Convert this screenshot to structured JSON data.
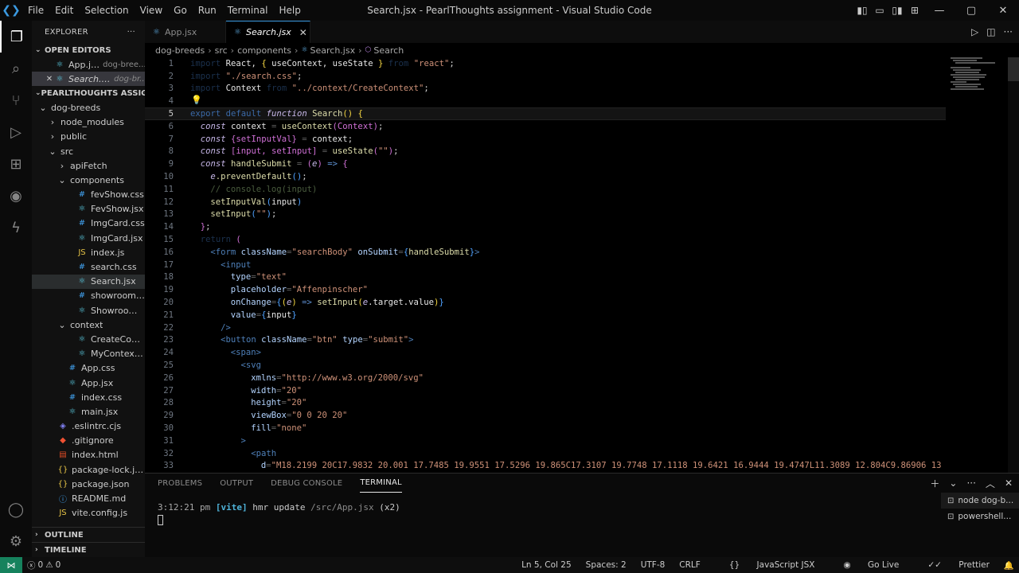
{
  "window": {
    "title": "Search.jsx - PearlThoughts assignment - Visual Studio Code",
    "menu": [
      "File",
      "Edit",
      "Selection",
      "View",
      "Go",
      "Run",
      "Terminal",
      "Help"
    ]
  },
  "explorer": {
    "header": "EXPLORER",
    "more": "···",
    "open_editors_label": "OPEN EDITORS",
    "open_editors": [
      {
        "name": "App.jsx",
        "desc": "dog-bree...",
        "icon": "react-icon",
        "italic": false
      },
      {
        "name": "Search.jsx",
        "desc": "dog-br...",
        "icon": "react-icon",
        "italic": true
      }
    ],
    "project_label": "PEARLTHOUGHTS ASSIGN...",
    "tree": [
      {
        "name": "dog-breeds",
        "depth": 1,
        "type": "folder",
        "open": true
      },
      {
        "name": "node_modules",
        "depth": 2,
        "type": "folder",
        "open": false
      },
      {
        "name": "public",
        "depth": 2,
        "type": "folder",
        "open": false
      },
      {
        "name": "src",
        "depth": 2,
        "type": "folder",
        "open": true
      },
      {
        "name": "apiFetch",
        "depth": 3,
        "type": "folder",
        "open": false
      },
      {
        "name": "components",
        "depth": 3,
        "type": "folder",
        "open": true
      },
      {
        "name": "fevShow.css",
        "depth": 4,
        "type": "css"
      },
      {
        "name": "FevShow.jsx",
        "depth": 4,
        "type": "jsx"
      },
      {
        "name": "ImgCard.css",
        "depth": 4,
        "type": "css"
      },
      {
        "name": "ImgCard.jsx",
        "depth": 4,
        "type": "jsx"
      },
      {
        "name": "index.js",
        "depth": 4,
        "type": "js"
      },
      {
        "name": "search.css",
        "depth": 4,
        "type": "css"
      },
      {
        "name": "Search.jsx",
        "depth": 4,
        "type": "jsx",
        "selected": true
      },
      {
        "name": "showroom.css",
        "depth": 4,
        "type": "css"
      },
      {
        "name": "Showroom.jsx",
        "depth": 4,
        "type": "jsx"
      },
      {
        "name": "context",
        "depth": 3,
        "type": "folder",
        "open": true
      },
      {
        "name": "CreateContex...",
        "depth": 4,
        "type": "jsx"
      },
      {
        "name": "MyContext.jsx",
        "depth": 4,
        "type": "jsx"
      },
      {
        "name": "App.css",
        "depth": 3,
        "type": "css"
      },
      {
        "name": "App.jsx",
        "depth": 3,
        "type": "jsx"
      },
      {
        "name": "index.css",
        "depth": 3,
        "type": "css"
      },
      {
        "name": "main.jsx",
        "depth": 3,
        "type": "jsx"
      },
      {
        "name": ".eslintrc.cjs",
        "depth": 2,
        "type": "eslint"
      },
      {
        "name": ".gitignore",
        "depth": 2,
        "type": "git"
      },
      {
        "name": "index.html",
        "depth": 2,
        "type": "html"
      },
      {
        "name": "package-lock.json",
        "depth": 2,
        "type": "json"
      },
      {
        "name": "package.json",
        "depth": 2,
        "type": "json"
      },
      {
        "name": "README.md",
        "depth": 2,
        "type": "md"
      },
      {
        "name": "vite.config.js",
        "depth": 2,
        "type": "js"
      }
    ],
    "outline_label": "OUTLINE",
    "timeline_label": "TIMELINE"
  },
  "tabs": [
    {
      "label": "App.jsx",
      "active": false
    },
    {
      "label": "Search.jsx",
      "active": true
    }
  ],
  "breadcrumb": [
    "dog-breeds",
    "src",
    "components",
    "Search.jsx",
    "Search"
  ],
  "editor": {
    "current_line": 5,
    "lines": [
      {
        "n": 1,
        "ind": 0,
        "t": [
          [
            "import",
            "kw dim"
          ],
          [
            " React, ",
            "var"
          ],
          [
            "{ ",
            "br1"
          ],
          [
            "useContext, useState ",
            "var"
          ],
          [
            "}",
            "br1"
          ],
          [
            " from ",
            "kw dim"
          ],
          [
            "\"react\"",
            "str"
          ],
          [
            ";",
            "pun"
          ]
        ]
      },
      {
        "n": 2,
        "ind": 0,
        "t": [
          [
            "import ",
            "kw dim"
          ],
          [
            "\"./search.css\"",
            "str"
          ],
          [
            ";",
            "pun"
          ]
        ]
      },
      {
        "n": 3,
        "ind": 0,
        "t": [
          [
            "import ",
            "kw dim"
          ],
          [
            "Context ",
            "var"
          ],
          [
            "from ",
            "kw dim"
          ],
          [
            "\"../context/CreateContext\"",
            "str"
          ],
          [
            ";",
            "pun"
          ]
        ]
      },
      {
        "n": 4,
        "ind": 0,
        "t": []
      },
      {
        "n": 5,
        "ind": 0,
        "t": [
          [
            "export default ",
            "kw"
          ],
          [
            "function ",
            "it"
          ],
          [
            "Search",
            "fn"
          ],
          [
            "() ",
            "br1"
          ],
          [
            "{",
            "br1"
          ]
        ]
      },
      {
        "n": 6,
        "ind": 1,
        "t": [
          [
            "const ",
            "it"
          ],
          [
            "context",
            "var"
          ],
          [
            " = ",
            "pun dim"
          ],
          [
            "useContext",
            "fn"
          ],
          [
            "(Context)",
            "br2"
          ],
          [
            ";",
            "pun"
          ]
        ]
      },
      {
        "n": 7,
        "ind": 1,
        "t": [
          [
            "const ",
            "it"
          ],
          [
            "{setInputVal}",
            "br2"
          ],
          [
            " = ",
            "pun dim"
          ],
          [
            "context",
            "var"
          ],
          [
            ";",
            "pun"
          ]
        ]
      },
      {
        "n": 8,
        "ind": 1,
        "t": [
          [
            "const ",
            "it"
          ],
          [
            "[input, setInput]",
            "br2"
          ],
          [
            " = ",
            "pun dim"
          ],
          [
            "useState",
            "fn"
          ],
          [
            "(",
            "br2"
          ],
          [
            "\"\"",
            "str"
          ],
          [
            ")",
            "br2"
          ],
          [
            ";",
            "pun"
          ]
        ]
      },
      {
        "n": 9,
        "ind": 1,
        "t": [
          [
            "const ",
            "it"
          ],
          [
            "handleSubmit",
            "fn"
          ],
          [
            " = ",
            "pun dim"
          ],
          [
            "(",
            "br2"
          ],
          [
            "e",
            "it"
          ],
          [
            ") ",
            "br2"
          ],
          [
            "=> ",
            "kw2"
          ],
          [
            "{",
            "br2"
          ]
        ]
      },
      {
        "n": 10,
        "ind": 2,
        "t": [
          [
            "e",
            "it"
          ],
          [
            ".preventDefault",
            "fn"
          ],
          [
            "()",
            "br3"
          ],
          [
            ";",
            "pun"
          ]
        ]
      },
      {
        "n": 11,
        "ind": 2,
        "t": [
          [
            "// console.log(input)",
            "cm"
          ]
        ]
      },
      {
        "n": 12,
        "ind": 2,
        "t": [
          [
            "setInputVal",
            "fn"
          ],
          [
            "(",
            "br3"
          ],
          [
            "input",
            "var"
          ],
          [
            ")",
            "br3"
          ]
        ]
      },
      {
        "n": 13,
        "ind": 2,
        "t": [
          [
            "setInput",
            "fn"
          ],
          [
            "(",
            "br3"
          ],
          [
            "\"\"",
            "str"
          ],
          [
            ")",
            "br3"
          ],
          [
            ";",
            "pun"
          ]
        ]
      },
      {
        "n": 14,
        "ind": 1,
        "t": [
          [
            "}",
            "br2"
          ],
          [
            ";",
            "pun"
          ]
        ]
      },
      {
        "n": 15,
        "ind": 1,
        "t": [
          [
            "return ",
            "kw dim"
          ],
          [
            "(",
            "br2"
          ]
        ]
      },
      {
        "n": 16,
        "ind": 2,
        "t": [
          [
            "<form ",
            "tag"
          ],
          [
            "className",
            "attr"
          ],
          [
            "=",
            "pun dim"
          ],
          [
            "\"searchBody\" ",
            "str"
          ],
          [
            "onSubmit",
            "attr"
          ],
          [
            "=",
            "pun dim"
          ],
          [
            "{",
            "br3"
          ],
          [
            "handleSubmit",
            "fn"
          ],
          [
            "}",
            "br3"
          ],
          [
            ">",
            "tag"
          ]
        ]
      },
      {
        "n": 17,
        "ind": 3,
        "t": [
          [
            "<input",
            "tag"
          ]
        ]
      },
      {
        "n": 18,
        "ind": 4,
        "t": [
          [
            "type",
            "attr"
          ],
          [
            "=",
            "pun dim"
          ],
          [
            "\"text\"",
            "str"
          ]
        ]
      },
      {
        "n": 19,
        "ind": 4,
        "t": [
          [
            "placeholder",
            "attr"
          ],
          [
            "=",
            "pun dim"
          ],
          [
            "\"Affenpinscher\"",
            "str"
          ]
        ]
      },
      {
        "n": 20,
        "ind": 4,
        "t": [
          [
            "onChange",
            "attr"
          ],
          [
            "=",
            "pun dim"
          ],
          [
            "{",
            "br3"
          ],
          [
            "(",
            "br1"
          ],
          [
            "e",
            "it"
          ],
          [
            ") ",
            "br1"
          ],
          [
            "=> ",
            "kw2"
          ],
          [
            "setInput",
            "fn"
          ],
          [
            "(",
            "br1"
          ],
          [
            "e",
            "it"
          ],
          [
            ".target.value",
            "var"
          ],
          [
            ")",
            "br1"
          ],
          [
            "}",
            "br3"
          ]
        ]
      },
      {
        "n": 21,
        "ind": 4,
        "t": [
          [
            "value",
            "attr"
          ],
          [
            "=",
            "pun dim"
          ],
          [
            "{",
            "br3"
          ],
          [
            "input",
            "var"
          ],
          [
            "}",
            "br3"
          ]
        ]
      },
      {
        "n": 22,
        "ind": 3,
        "t": [
          [
            "/>",
            "tag"
          ]
        ]
      },
      {
        "n": 23,
        "ind": 3,
        "t": [
          [
            "<button ",
            "tag"
          ],
          [
            "className",
            "attr"
          ],
          [
            "=",
            "pun dim"
          ],
          [
            "\"btn\" ",
            "str"
          ],
          [
            "type",
            "attr"
          ],
          [
            "=",
            "pun dim"
          ],
          [
            "\"submit\"",
            "str"
          ],
          [
            ">",
            "tag"
          ]
        ]
      },
      {
        "n": 24,
        "ind": 4,
        "t": [
          [
            "<span>",
            "tag"
          ]
        ]
      },
      {
        "n": 25,
        "ind": 5,
        "t": [
          [
            "<svg",
            "tag"
          ]
        ]
      },
      {
        "n": 26,
        "ind": 6,
        "t": [
          [
            "xmlns",
            "attr"
          ],
          [
            "=",
            "pun dim"
          ],
          [
            "\"http://www.w3.org/2000/svg\"",
            "str"
          ]
        ]
      },
      {
        "n": 27,
        "ind": 6,
        "t": [
          [
            "width",
            "attr"
          ],
          [
            "=",
            "pun dim"
          ],
          [
            "\"20\"",
            "str"
          ]
        ]
      },
      {
        "n": 28,
        "ind": 6,
        "t": [
          [
            "height",
            "attr"
          ],
          [
            "=",
            "pun dim"
          ],
          [
            "\"20\"",
            "str"
          ]
        ]
      },
      {
        "n": 29,
        "ind": 6,
        "t": [
          [
            "viewBox",
            "attr"
          ],
          [
            "=",
            "pun dim"
          ],
          [
            "\"0 0 20 20\"",
            "str"
          ]
        ]
      },
      {
        "n": 30,
        "ind": 6,
        "t": [
          [
            "fill",
            "attr"
          ],
          [
            "=",
            "pun dim"
          ],
          [
            "\"none\"",
            "str"
          ]
        ]
      },
      {
        "n": 31,
        "ind": 5,
        "t": [
          [
            ">",
            "tag"
          ]
        ]
      },
      {
        "n": 32,
        "ind": 6,
        "t": [
          [
            "<path",
            "tag"
          ]
        ]
      },
      {
        "n": 33,
        "ind": 7,
        "t": [
          [
            "d",
            "attr"
          ],
          [
            "=",
            "pun dim"
          ],
          [
            "\"M18.2199 20C17.9832 20.001 17.7485 19.9551 17.5296 19.865C17.3107 19.7748 17.1118 19.6421 16.9444 19.4747L11.3089 12.804C9.86906 13",
            "str"
          ]
        ]
      }
    ]
  },
  "panel": {
    "tabs": [
      "PROBLEMS",
      "OUTPUT",
      "DEBUG CONSOLE",
      "TERMINAL"
    ],
    "active_tab": "TERMINAL",
    "terminal_time": "3:12:21 pm",
    "terminal_tag": "[vite]",
    "terminal_msg": "hmr update",
    "terminal_path": "/src/App.jsx",
    "terminal_count": "(x2)",
    "terminals": [
      {
        "label": "node dog-b...",
        "active": true
      },
      {
        "label": "powershell...",
        "active": false
      }
    ]
  },
  "status": {
    "errors": "0",
    "warnings": "0",
    "position": "Ln 5, Col 25",
    "spaces": "Spaces: 2",
    "encoding": "UTF-8",
    "eol": "CRLF",
    "language": "JavaScript JSX",
    "golive": "Go Live",
    "prettier": "Prettier"
  },
  "colors": {
    "accent": "#3b9ae1",
    "remote": "#16825d",
    "background": "#000000"
  }
}
